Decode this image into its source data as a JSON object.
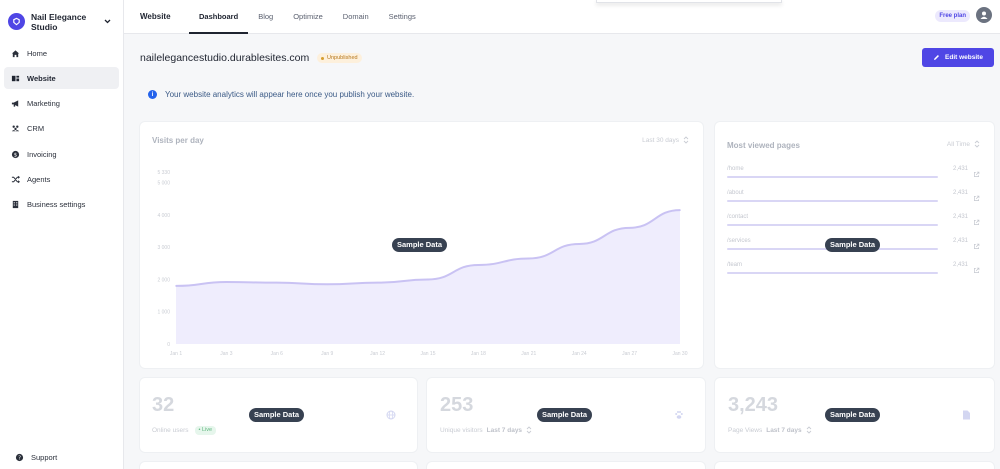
{
  "brand": {
    "name": "Nail Elegance Studio"
  },
  "sidebar": {
    "items": [
      {
        "label": "Home",
        "icon": "home-icon"
      },
      {
        "label": "Website",
        "icon": "website-icon",
        "active": true
      },
      {
        "label": "Marketing",
        "icon": "megaphone-icon"
      },
      {
        "label": "CRM",
        "icon": "users-icon"
      },
      {
        "label": "Invoicing",
        "icon": "dollar-icon"
      },
      {
        "label": "Agents",
        "icon": "shuffle-icon"
      },
      {
        "label": "Business settings",
        "icon": "building-icon"
      }
    ],
    "support_label": "Support"
  },
  "topbar": {
    "section": "Website",
    "tabs": [
      "Dashboard",
      "Blog",
      "Optimize",
      "Domain",
      "Settings"
    ],
    "active_tab": "Dashboard",
    "plan": "Free plan"
  },
  "site": {
    "domain": "nailelegancestudio.durablesites.com",
    "status": "Unpublished",
    "edit_label": "Edit website"
  },
  "info": {
    "message": "Your website analytics will appear here once you publish your website."
  },
  "visits": {
    "title": "Visits per day",
    "range": "Last 30 days",
    "sample_label": "Sample Data"
  },
  "chart_data": {
    "type": "area",
    "title": "Visits per day",
    "categories": [
      "Jan 1",
      "Jan 3",
      "Jan 6",
      "Jan 9",
      "Jan 12",
      "Jan 15",
      "Jan 18",
      "Jan 21",
      "Jan 24",
      "Jan 27",
      "Jan 30"
    ],
    "y_ticks": [
      "0",
      "1 000",
      "2 000",
      "3 000",
      "4 000",
      "5 000",
      "5 330"
    ],
    "series": [
      {
        "values": [
          1800,
          1920,
          1900,
          1850,
          1900,
          2000,
          2450,
          2650,
          3100,
          3600,
          4150
        ]
      }
    ],
    "ylim": [
      0,
      5330
    ],
    "grid": false,
    "color": "#c9c2f3"
  },
  "pages": {
    "title": "Most viewed pages",
    "range": "All Time",
    "sample_label": "Sample Data",
    "items": [
      {
        "path": "/home",
        "views": "2,431"
      },
      {
        "path": "/about",
        "views": "2,431"
      },
      {
        "path": "/contact",
        "views": "2,431"
      },
      {
        "path": "/services",
        "views": "2,431"
      },
      {
        "path": "/team",
        "views": "2,431"
      }
    ]
  },
  "stats": [
    {
      "value": "32",
      "label": "Online users",
      "badge": "Live",
      "sample": "Sample Data",
      "icon": "globe-icon"
    },
    {
      "value": "253",
      "label": "Unique visitors",
      "sub": "Last 7 days",
      "sample": "Sample Data",
      "icon": "paw-icon"
    },
    {
      "value": "3,243",
      "label": "Page Views",
      "sub": "Last 7 days",
      "sample": "Sample Data",
      "icon": "document-icon"
    }
  ],
  "colors": {
    "accent": "#4f46e5",
    "warning": "#d69e2e",
    "info": "#2563eb"
  }
}
